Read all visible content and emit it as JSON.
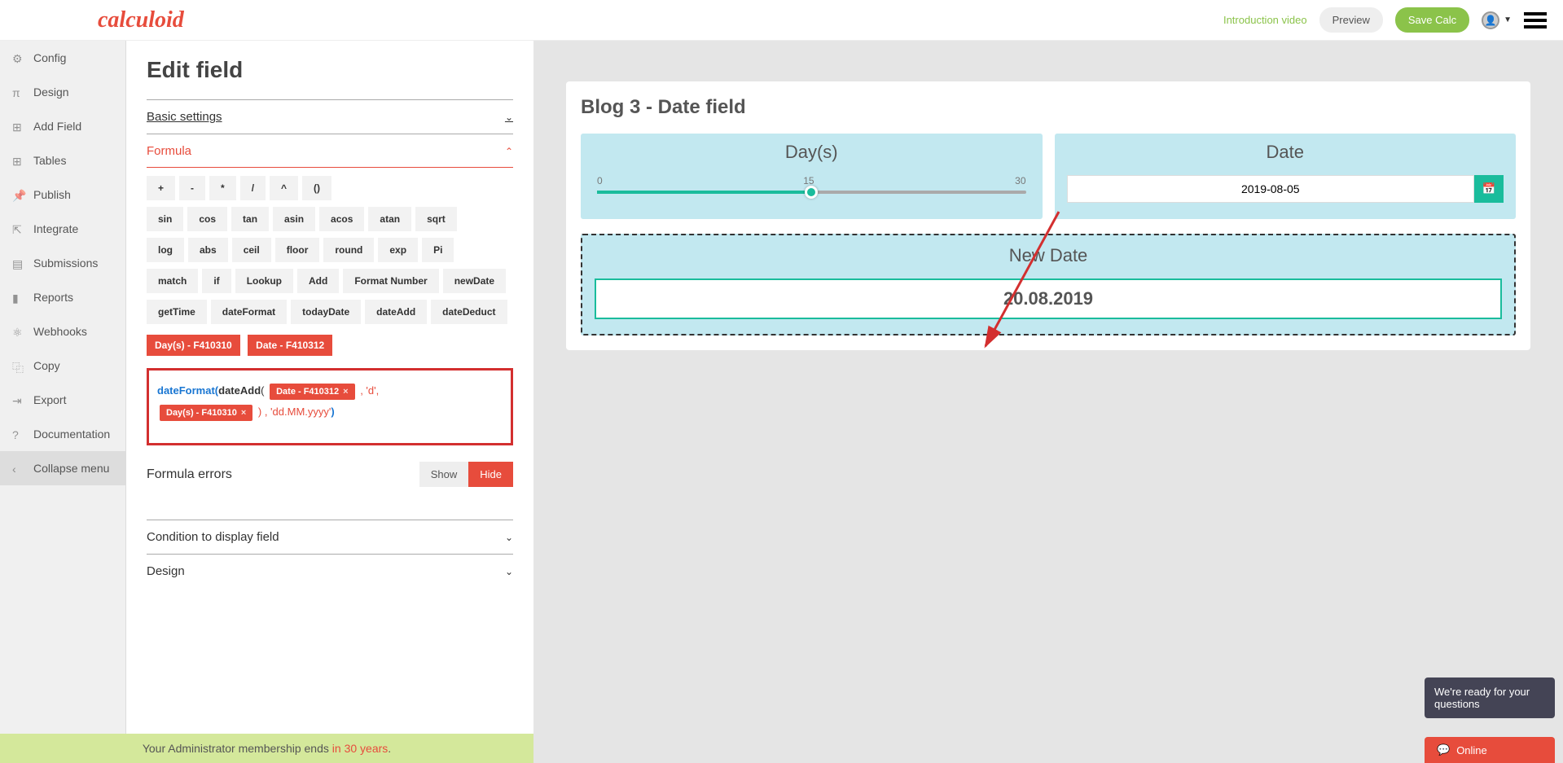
{
  "header": {
    "logo": "calculoid",
    "intro_video": "Introduction video",
    "preview": "Preview",
    "save": "Save Calc"
  },
  "sidebar": {
    "items": [
      {
        "label": "Config",
        "icon": "gear"
      },
      {
        "label": "Design",
        "icon": "design"
      },
      {
        "label": "Add Field",
        "icon": "plus"
      },
      {
        "label": "Tables",
        "icon": "table"
      },
      {
        "label": "Publish",
        "icon": "thumbtack"
      },
      {
        "label": "Integrate",
        "icon": "merge"
      },
      {
        "label": "Submissions",
        "icon": "archive"
      },
      {
        "label": "Reports",
        "icon": "chart"
      },
      {
        "label": "Webhooks",
        "icon": "share"
      },
      {
        "label": "Copy",
        "icon": "copy"
      },
      {
        "label": "Export",
        "icon": "export"
      },
      {
        "label": "Documentation",
        "icon": "help"
      },
      {
        "label": "Collapse menu",
        "icon": "chevron-left"
      }
    ]
  },
  "edit": {
    "title": "Edit field",
    "basic_settings": "Basic settings",
    "formula": "Formula",
    "operators1": [
      "+",
      "-",
      "*",
      "/",
      "^",
      "()"
    ],
    "operators2": [
      "sin",
      "cos",
      "tan",
      "asin",
      "acos",
      "atan",
      "sqrt"
    ],
    "operators3": [
      "log",
      "abs",
      "ceil",
      "floor",
      "round",
      "exp",
      "Pi"
    ],
    "operators4": [
      "match",
      "if",
      "Lookup",
      "Add",
      "Format Number",
      "newDate"
    ],
    "operators5": [
      "getTime",
      "dateFormat",
      "todayDate",
      "dateAdd",
      "dateDeduct"
    ],
    "field_tags": [
      "Day(s) - F410310",
      "Date - F410312"
    ],
    "formula_parts": {
      "fn1": "dateFormat",
      "fn2": "dateAdd",
      "tag1": "Date - F410312",
      "arg1": ", 'd',",
      "tag2": "Day(s) - F410310",
      "arg2": ") , 'dd.MM.yyyy'",
      "x": "×"
    },
    "formula_errors": "Formula errors",
    "show": "Show",
    "hide": "Hide",
    "condition": "Condition to display field",
    "design": "Design"
  },
  "preview": {
    "title": "Blog 3 - Date field",
    "days_label": "Day(s)",
    "slider": {
      "min": "0",
      "mid": "15",
      "max": "30"
    },
    "date_label": "Date",
    "date_value": "2019-08-05",
    "new_date_label": "New Date",
    "new_date_value": "20.08.2019"
  },
  "chat": {
    "bubble": "We're ready for your questions",
    "status": "Online"
  },
  "footer": {
    "text": "Your Administrator membership ends ",
    "years": "in 30 years",
    "dot": "."
  }
}
